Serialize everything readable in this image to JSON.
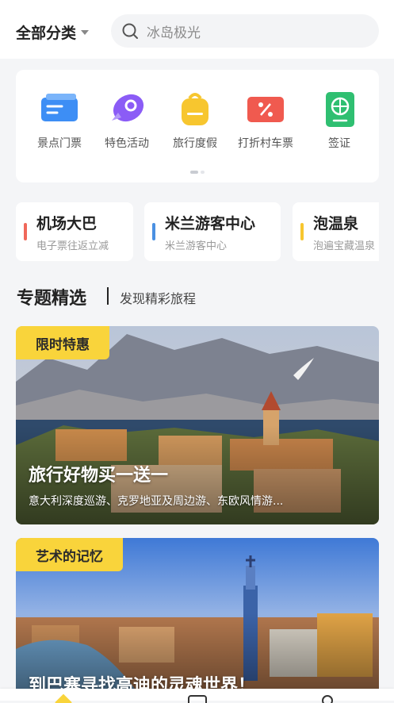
{
  "header": {
    "category_label": "全部分类",
    "search_placeholder": "冰岛极光"
  },
  "categories": [
    {
      "label": "景点门票",
      "icon": "ticket-icon",
      "color": "#3d8ef5"
    },
    {
      "label": "特色活动",
      "icon": "rocket-icon",
      "color": "#8b5cf6"
    },
    {
      "label": "旅行度假",
      "icon": "backpack-icon",
      "color": "#f7c62f"
    },
    {
      "label": "打折村车票",
      "icon": "discount-ticket-icon",
      "color": "#f05a4f"
    },
    {
      "label": "签证",
      "icon": "passport-icon",
      "color": "#2fbf71"
    }
  ],
  "quick_links": [
    {
      "title": "机场大巴",
      "subtitle": "电子票往返立减",
      "color": "#f0685a"
    },
    {
      "title": "米兰游客中心",
      "subtitle": "米兰游客中心",
      "color": "#4a90e2"
    },
    {
      "title": "泡温泉",
      "subtitle": "泡遍宝藏温泉",
      "color": "#f7c62f"
    }
  ],
  "section": {
    "title": "专题精选",
    "subtitle": "发现精彩旅程"
  },
  "promos": [
    {
      "tag": "限时特惠",
      "title": "旅行好物买一送一",
      "subtitle": "意大利深度巡游、克罗地亚及周边游、东欧风情游..."
    },
    {
      "tag": "艺术的记忆",
      "title": "到巴塞寻找高迪的灵魂世界！",
      "subtitle": ""
    }
  ],
  "tabbar": {
    "icons": [
      "home-icon",
      "list-icon",
      "profile-icon"
    ]
  }
}
